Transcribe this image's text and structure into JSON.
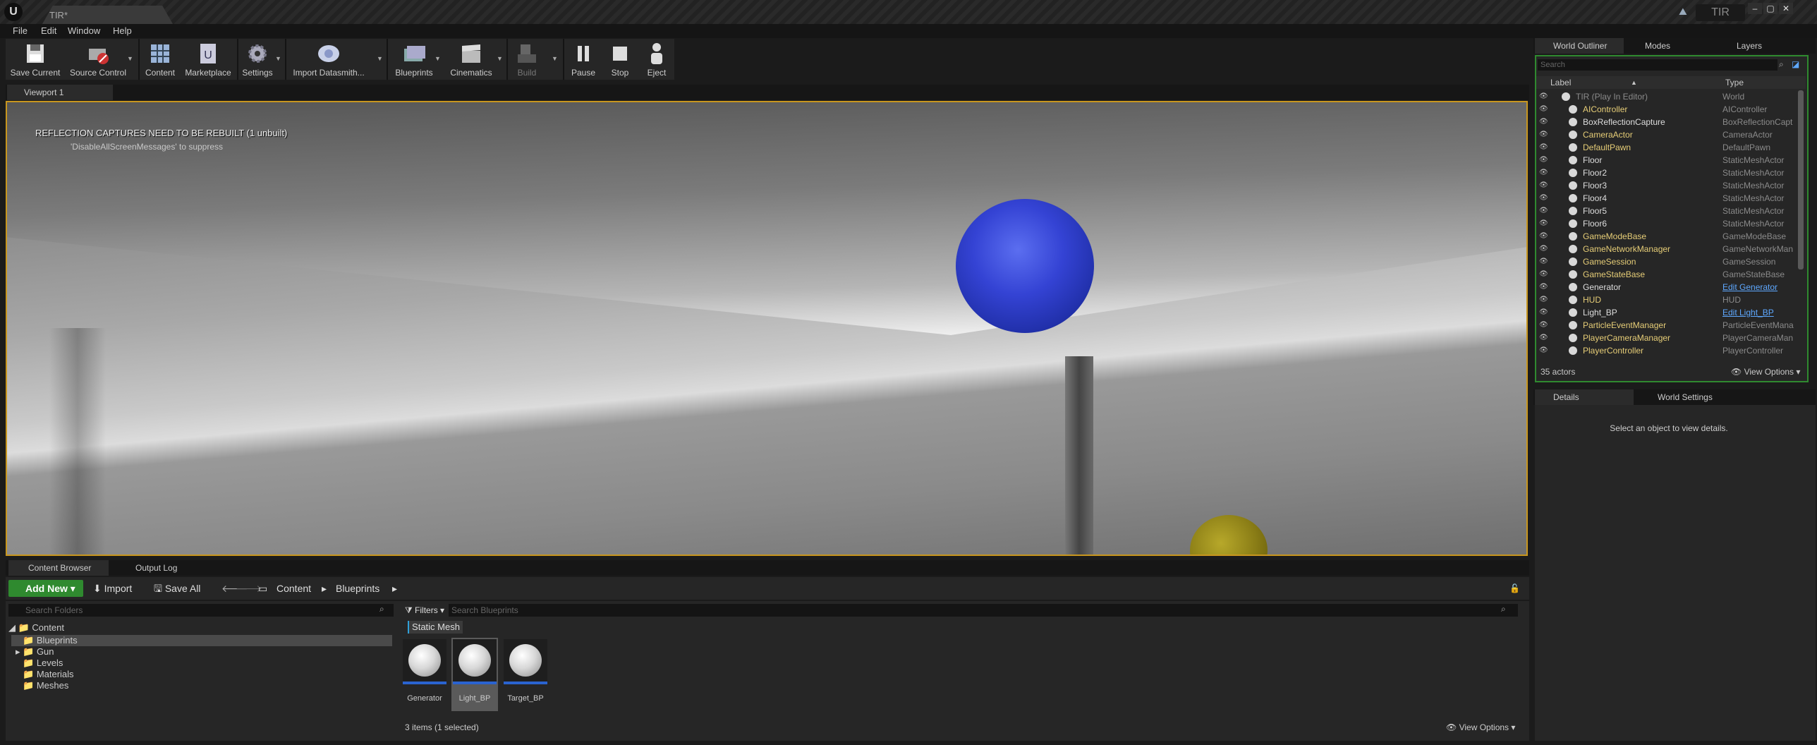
{
  "window": {
    "doc_tab": "TIR*",
    "project_name": "TIR",
    "minimize": "–",
    "restore": "▢",
    "close": "✕"
  },
  "menu": [
    "File",
    "Edit",
    "Window",
    "Help"
  ],
  "toolbar": {
    "save_current": "Save Current",
    "source_control": "Source Control",
    "content": "Content",
    "marketplace": "Marketplace",
    "settings": "Settings",
    "import_datasmith": "Import Datasmith...",
    "blueprints": "Blueprints",
    "cinematics": "Cinematics",
    "build": "Build",
    "pause": "Pause",
    "stop": "Stop",
    "eject": "Eject"
  },
  "viewport": {
    "tab": "Viewport 1",
    "message": "REFLECTION CAPTURES NEED TO BE REBUILT (1 unbuilt)",
    "hint": "'DisableAllScreenMessages' to suppress"
  },
  "content_browser": {
    "tab_content_browser": "Content Browser",
    "tab_output_log": "Output Log",
    "add_new": "Add New",
    "import": "Import",
    "save_all": "Save All",
    "breadcrumb": [
      "Content",
      "Blueprints"
    ],
    "folder_search_placeholder": "Search Folders",
    "asset_search_placeholder": "Search Blueprints",
    "filters": "Filters",
    "filter_chip": "Static Mesh",
    "tree": [
      {
        "label": "Content"
      },
      {
        "label": "Blueprints"
      },
      {
        "label": "Gun"
      },
      {
        "label": "Levels"
      },
      {
        "label": "Materials"
      },
      {
        "label": "Meshes"
      }
    ],
    "assets": [
      {
        "label": "Generator",
        "selected": false
      },
      {
        "label": "Light_BP",
        "selected": true
      },
      {
        "label": "Target_BP",
        "selected": false
      }
    ],
    "items_count": "3 items (1 selected)",
    "view_options": "View Options"
  },
  "right_panel_tabs": {
    "world_outliner": "World Outliner",
    "modes": "Modes",
    "layers": "Layers"
  },
  "outliner": {
    "search_placeholder": "Search",
    "col_label": "Label",
    "col_type": "Type",
    "rows": [
      {
        "label": "TIR (Play In Editor)",
        "type": "World",
        "style": "gry",
        "typestyle": "gry"
      },
      {
        "label": "AIController",
        "type": "AIController",
        "style": "yel",
        "typestyle": "gry"
      },
      {
        "label": "BoxReflectionCapture",
        "type": "BoxReflectionCapt",
        "style": "wht",
        "typestyle": "gry"
      },
      {
        "label": "CameraActor",
        "type": "CameraActor",
        "style": "yel",
        "typestyle": "gry"
      },
      {
        "label": "DefaultPawn",
        "type": "DefaultPawn",
        "style": "yel",
        "typestyle": "gry"
      },
      {
        "label": "Floor",
        "type": "StaticMeshActor",
        "style": "wht",
        "typestyle": "gry"
      },
      {
        "label": "Floor2",
        "type": "StaticMeshActor",
        "style": "wht",
        "typestyle": "gry"
      },
      {
        "label": "Floor3",
        "type": "StaticMeshActor",
        "style": "wht",
        "typestyle": "gry"
      },
      {
        "label": "Floor4",
        "type": "StaticMeshActor",
        "style": "wht",
        "typestyle": "gry"
      },
      {
        "label": "Floor5",
        "type": "StaticMeshActor",
        "style": "wht",
        "typestyle": "gry"
      },
      {
        "label": "Floor6",
        "type": "StaticMeshActor",
        "style": "wht",
        "typestyle": "gry"
      },
      {
        "label": "GameModeBase",
        "type": "GameModeBase",
        "style": "yel",
        "typestyle": "gry"
      },
      {
        "label": "GameNetworkManager",
        "type": "GameNetworkMan",
        "style": "yel",
        "typestyle": "gry"
      },
      {
        "label": "GameSession",
        "type": "GameSession",
        "style": "yel",
        "typestyle": "gry"
      },
      {
        "label": "GameStateBase",
        "type": "GameStateBase",
        "style": "yel",
        "typestyle": "gry"
      },
      {
        "label": "Generator",
        "type": "Edit Generator",
        "style": "wht",
        "typestyle": "lnk"
      },
      {
        "label": "HUD",
        "type": "HUD",
        "style": "yel",
        "typestyle": "gry"
      },
      {
        "label": "Light_BP",
        "type": "Edit Light_BP",
        "style": "wht",
        "typestyle": "lnk"
      },
      {
        "label": "ParticleEventManager",
        "type": "ParticleEventMana",
        "style": "yel",
        "typestyle": "gry"
      },
      {
        "label": "PlayerCameraManager",
        "type": "PlayerCameraMan",
        "style": "yel",
        "typestyle": "gry"
      },
      {
        "label": "PlayerController",
        "type": "PlayerController",
        "style": "yel",
        "typestyle": "gry"
      }
    ],
    "actor_count": "35 actors",
    "view_options": "View Options"
  },
  "details": {
    "tab_details": "Details",
    "tab_world_settings": "World Settings",
    "empty_message": "Select an object to view details."
  }
}
